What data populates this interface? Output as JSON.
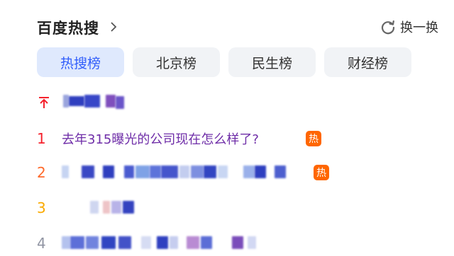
{
  "header": {
    "title": "百度热搜",
    "refresh_label": "换一换",
    "chevron_icon": "chevron-right-icon",
    "refresh_icon": "refresh-icon"
  },
  "tabs": [
    {
      "label": "热搜榜",
      "active": true
    },
    {
      "label": "北京榜",
      "active": false
    },
    {
      "label": "民生榜",
      "active": false
    },
    {
      "label": "财经榜",
      "active": false
    }
  ],
  "list": {
    "top_icon": "pin-top-icon",
    "items": [
      {
        "rank": "1",
        "text": "去年315曝光的公司现在怎么样了?",
        "badge": "热"
      },
      {
        "rank": "2",
        "text": "",
        "badge": "热"
      },
      {
        "rank": "3",
        "text": "",
        "badge": ""
      },
      {
        "rank": "4",
        "text": "",
        "badge": ""
      }
    ]
  },
  "colors": {
    "accent": "#315efb",
    "active_tab_bg": "#dfe9fd",
    "tab_bg": "#f1f3f6",
    "rank1": "#f5222d",
    "rank2": "#ff6a2b",
    "rank3": "#faaa00",
    "rank_other": "#9195a3",
    "badge_hot": "#ff6600",
    "item_text": "#6f2ea8"
  }
}
